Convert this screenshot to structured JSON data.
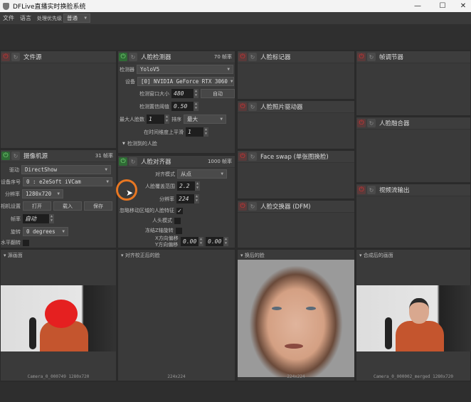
{
  "window": {
    "title": "DFLive直播实时换脸系统",
    "controls": [
      "—",
      "☐",
      "✕"
    ]
  },
  "menu": {
    "file": "文件",
    "language": "语言",
    "priority_label": "处理优先级",
    "priority_value": "普通"
  },
  "panels": {
    "file_source": {
      "title": "文件源",
      "enabled": false
    },
    "camera_source": {
      "title": "摄像机源",
      "enabled": true,
      "fps": "31 帧率",
      "driver_label": "驱动",
      "driver": "DirectShow",
      "device_label": "设备序号",
      "device": "0 : e2eSoft iVCam",
      "resolution_label": "分辨率",
      "resolution": "1280x720",
      "settings_label": "相机设置",
      "open": "打开",
      "load": "载入",
      "save": "保存",
      "fps_label": "帧率",
      "fps_value": "自动",
      "rotate_label": "旋转",
      "rotate": "0 degrees",
      "flip_label": "水平翻转"
    },
    "face_detector": {
      "title": "人脸检测器",
      "enabled": true,
      "fps": "70 帧率",
      "detector_label": "检测器",
      "detector": "YoloV5",
      "device_label": "设备",
      "device": "[0] NVIDIA GeForce RTX 3060",
      "window_label": "检测窗口大小",
      "window": "480",
      "auto": "自动",
      "threshold_label": "检测置信阈值",
      "threshold": "0.50",
      "max_faces_label": "最大人脸数",
      "max_faces": "1",
      "sort_label": "排序",
      "sort": "最大",
      "smooth_label": "在时间维度上平滑",
      "smooth": "1",
      "detected_label": "检测到的人脸"
    },
    "face_aligner": {
      "title": "人脸对齐器",
      "enabled": true,
      "fps": "1000 帧率",
      "mode_label": "对齐模式",
      "mode": "从点",
      "coverage_label": "人脸覆盖范围",
      "coverage": "2.2",
      "resolution_label": "分辨率",
      "resolution": "224",
      "exclude_label": "忽略移动区域的人脸特征",
      "exclude": true,
      "head_label": "人头模式",
      "head": false,
      "freeze_z_label": "冻结Z轴旋转",
      "freeze_z": false,
      "x_label": "X方向偏移",
      "y_label": "Y方向偏移",
      "x": "0.00",
      "y": "0.00"
    },
    "face_marker": {
      "title": "人脸标记器",
      "enabled": false
    },
    "face_animator": {
      "title": "人脸照片驱动器",
      "enabled": false
    },
    "face_swap_insight": {
      "title": "Face swap (单张图换脸)",
      "enabled": false
    },
    "face_swapper_dfm": {
      "title": "人脸交换器 (DFM)",
      "enabled": false
    },
    "frame_adjuster": {
      "title": "帧调节器",
      "enabled": false
    },
    "face_merger": {
      "title": "人脸融合器",
      "enabled": false
    },
    "stream_output": {
      "title": "视频流输出",
      "enabled": false
    }
  },
  "viewers": [
    {
      "title": "源画面",
      "caption": "Camera_0_000749 1280x720"
    },
    {
      "title": "对齐校正后的脸",
      "caption": "224x224"
    },
    {
      "title": "换后的脸",
      "caption": "224x224"
    },
    {
      "title": "合成后的画面",
      "caption": "Camera_0_000002_merged 1280x720"
    }
  ],
  "colors": {
    "power_on": "#2f6b35",
    "power_off": "#d33333",
    "background": "#3a3a3a",
    "cursor_highlight": "#e87722"
  }
}
